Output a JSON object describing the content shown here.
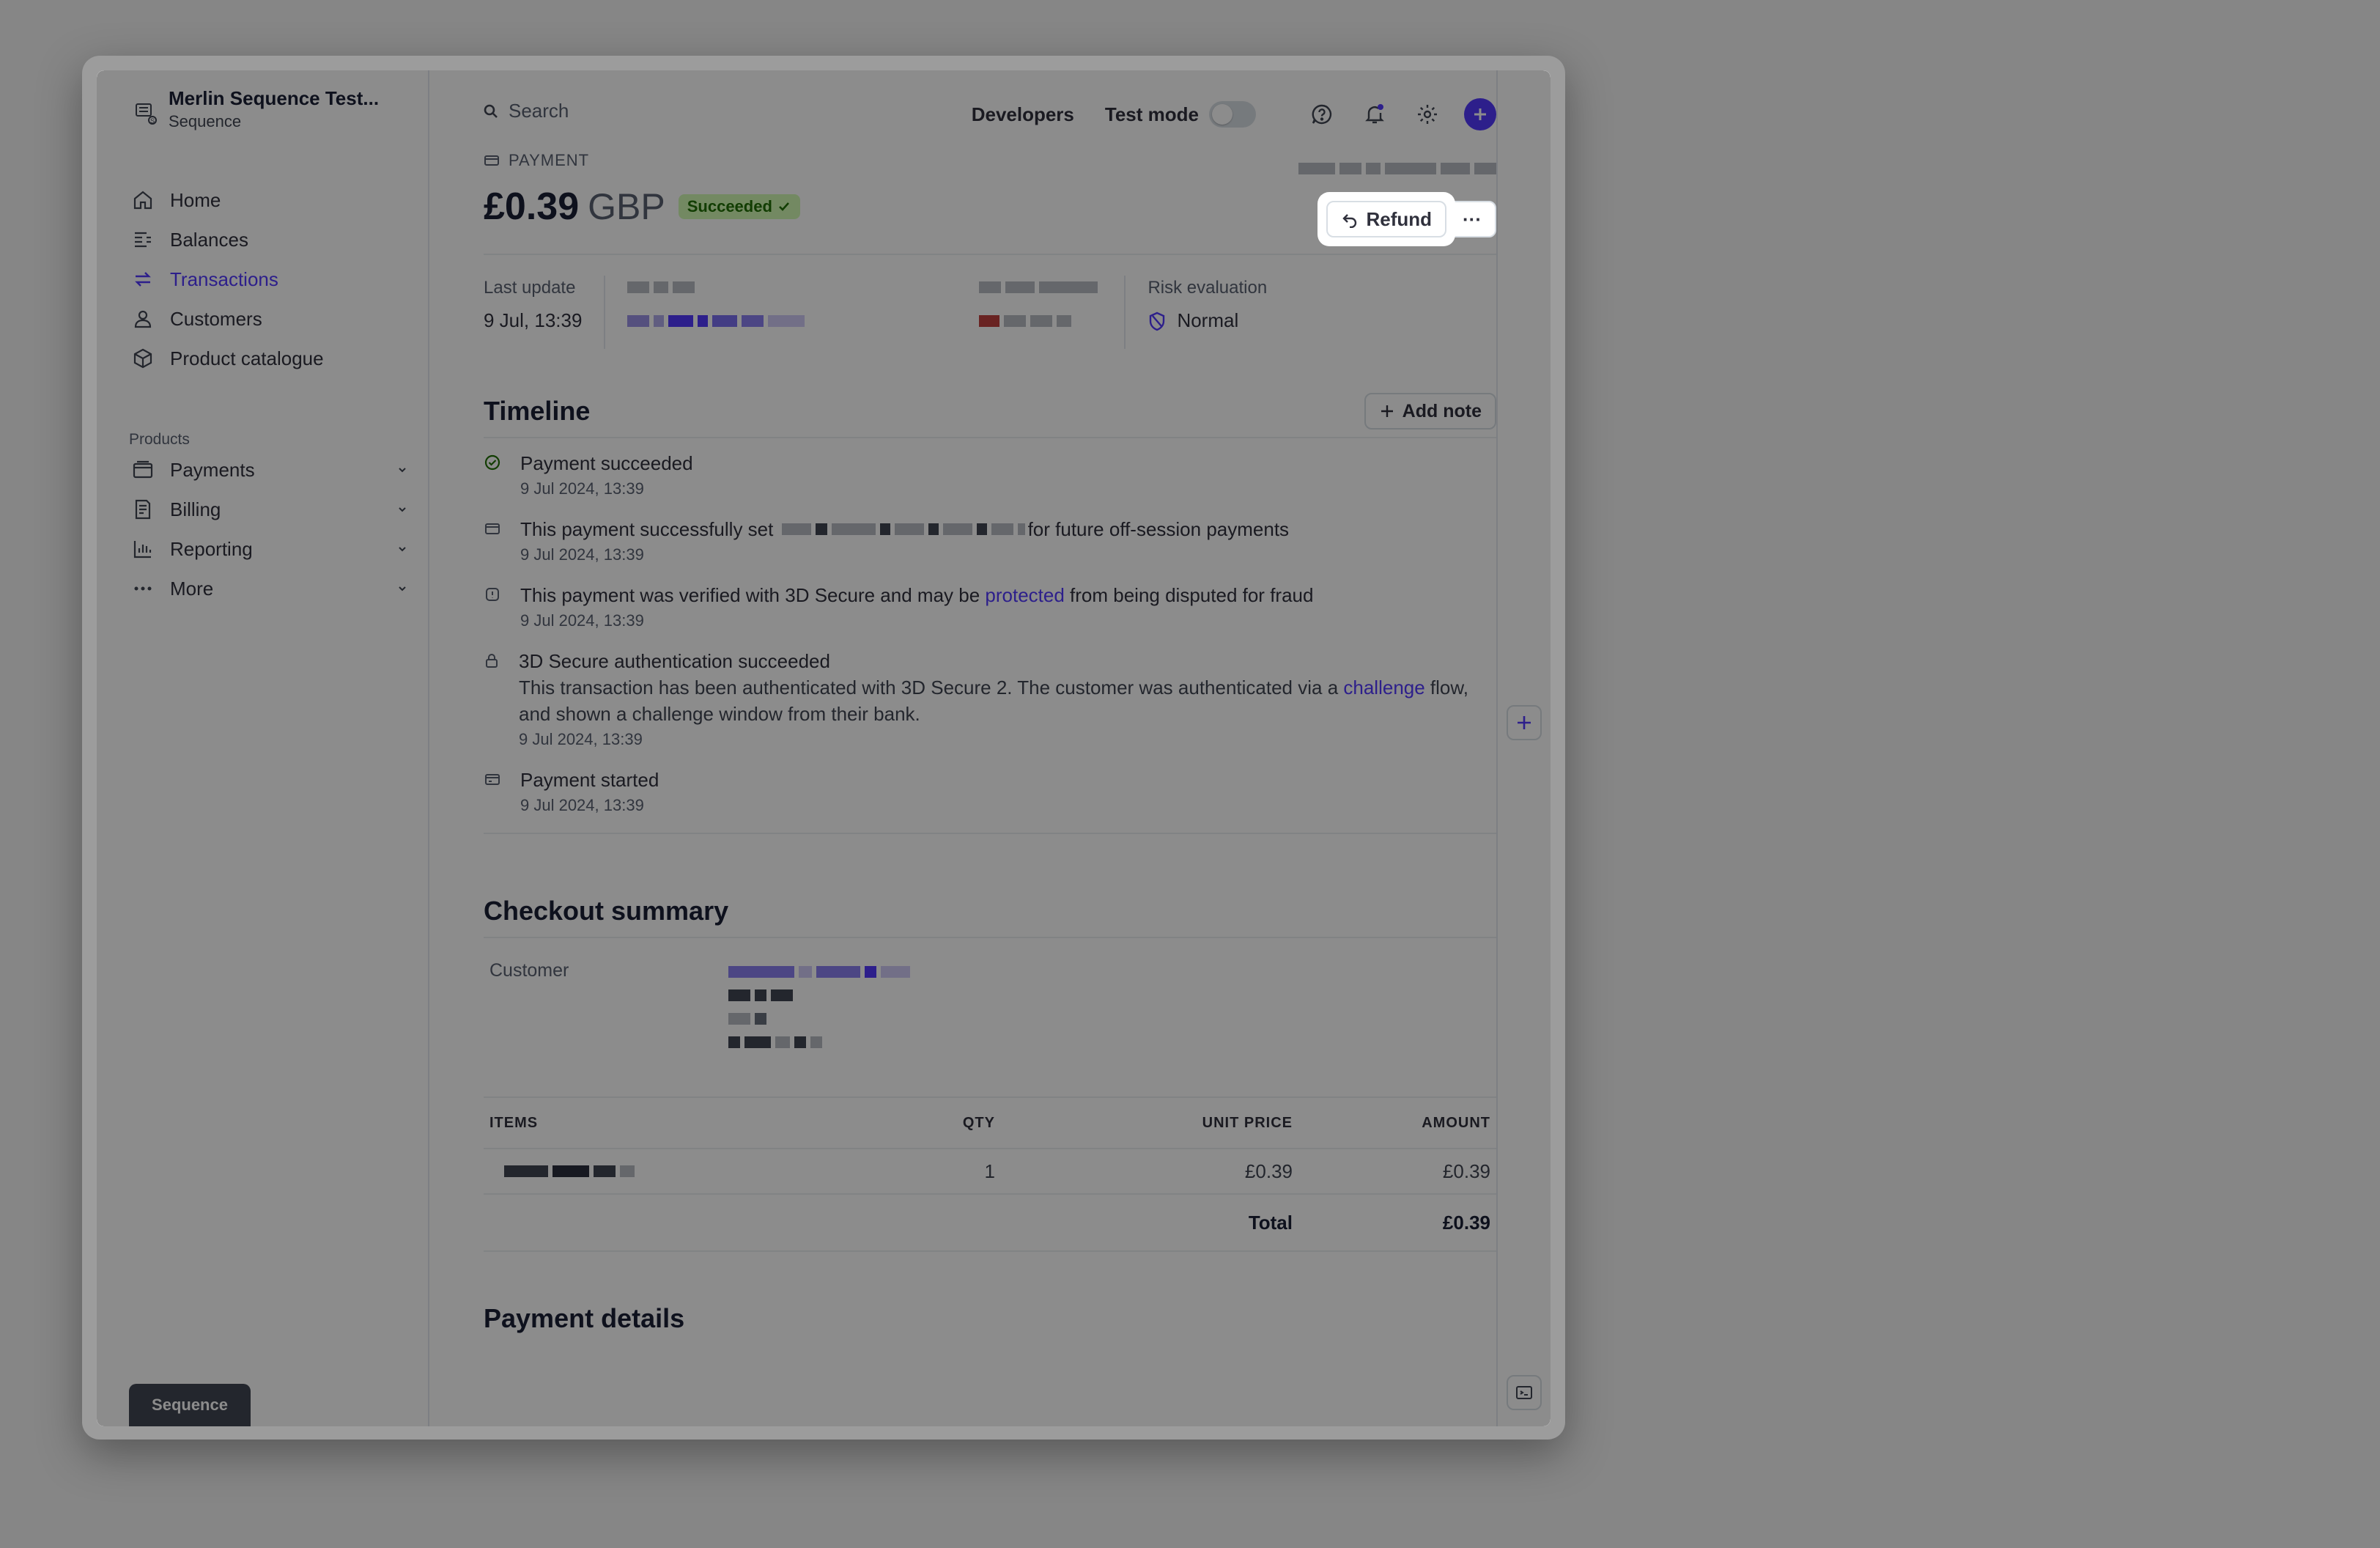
{
  "account": {
    "name": "Merlin Sequence Test...",
    "sub": "Sequence"
  },
  "nav": [
    {
      "label": "Home",
      "icon": "home-icon",
      "active": false
    },
    {
      "label": "Balances",
      "icon": "balances-icon",
      "active": false
    },
    {
      "label": "Transactions",
      "icon": "transactions-icon",
      "active": true
    },
    {
      "label": "Customers",
      "icon": "customers-icon",
      "active": false
    },
    {
      "label": "Product catalogue",
      "icon": "product-catalogue-icon",
      "active": false
    }
  ],
  "products_label": "Products",
  "products_nav": [
    {
      "label": "Payments",
      "icon": "payments-icon"
    },
    {
      "label": "Billing",
      "icon": "billing-icon"
    },
    {
      "label": "Reporting",
      "icon": "reporting-icon"
    },
    {
      "label": "More",
      "icon": "more-dots-icon"
    }
  ],
  "sandbox_label": "Sequence",
  "topbar": {
    "search_placeholder": "Search",
    "developers": "Developers",
    "test_mode": "Test mode"
  },
  "payment": {
    "kicker": "PAYMENT",
    "amount": "£0.39",
    "currency": "GBP",
    "status": "Succeeded",
    "refund_label": "Refund",
    "more_label": "···",
    "last_update_label": "Last update",
    "last_update_value": "9 Jul, 13:39",
    "risk_label": "Risk evaluation",
    "risk_value": "Normal"
  },
  "timeline": {
    "title": "Timeline",
    "add_note": "Add note",
    "events": [
      {
        "title": "Payment succeeded",
        "date": "9 Jul 2024, 13:39",
        "icon": "check-circle-icon"
      },
      {
        "title_pre": "This payment successfully set ",
        "title_post": "for future off-session payments",
        "date": "9 Jul 2024, 13:39",
        "icon": "card-icon"
      },
      {
        "title_pre": "This payment was verified with 3D Secure and may be ",
        "link": "protected",
        "title_post": " from being disputed for fraud",
        "date": "9 Jul 2024, 13:39",
        "icon": "info-icon"
      },
      {
        "title": "3D Secure authentication succeeded",
        "desc_pre": "This transaction has been authenticated with 3D Secure 2. The customer was authenticated via a ",
        "desc_link": "challenge",
        "desc_post": " flow, and shown a challenge window from their bank.",
        "date": "9 Jul 2024, 13:39",
        "icon": "lock-icon"
      },
      {
        "title": "Payment started",
        "date": "9 Jul 2024, 13:39",
        "icon": "payment-icon"
      }
    ]
  },
  "checkout": {
    "title": "Checkout summary",
    "customer_label": "Customer",
    "columns": {
      "items": "ITEMS",
      "qty": "QTY",
      "unit": "UNIT PRICE",
      "amount": "AMOUNT"
    },
    "rows": [
      {
        "qty": "1",
        "unit": "£0.39",
        "amount": "£0.39"
      }
    ],
    "total_label": "Total",
    "total_value": "£0.39"
  },
  "payment_details_title": "Payment details",
  "colors": {
    "accent": "#533afd",
    "success_bg": "#d1fab3",
    "success_fg": "#217005"
  }
}
